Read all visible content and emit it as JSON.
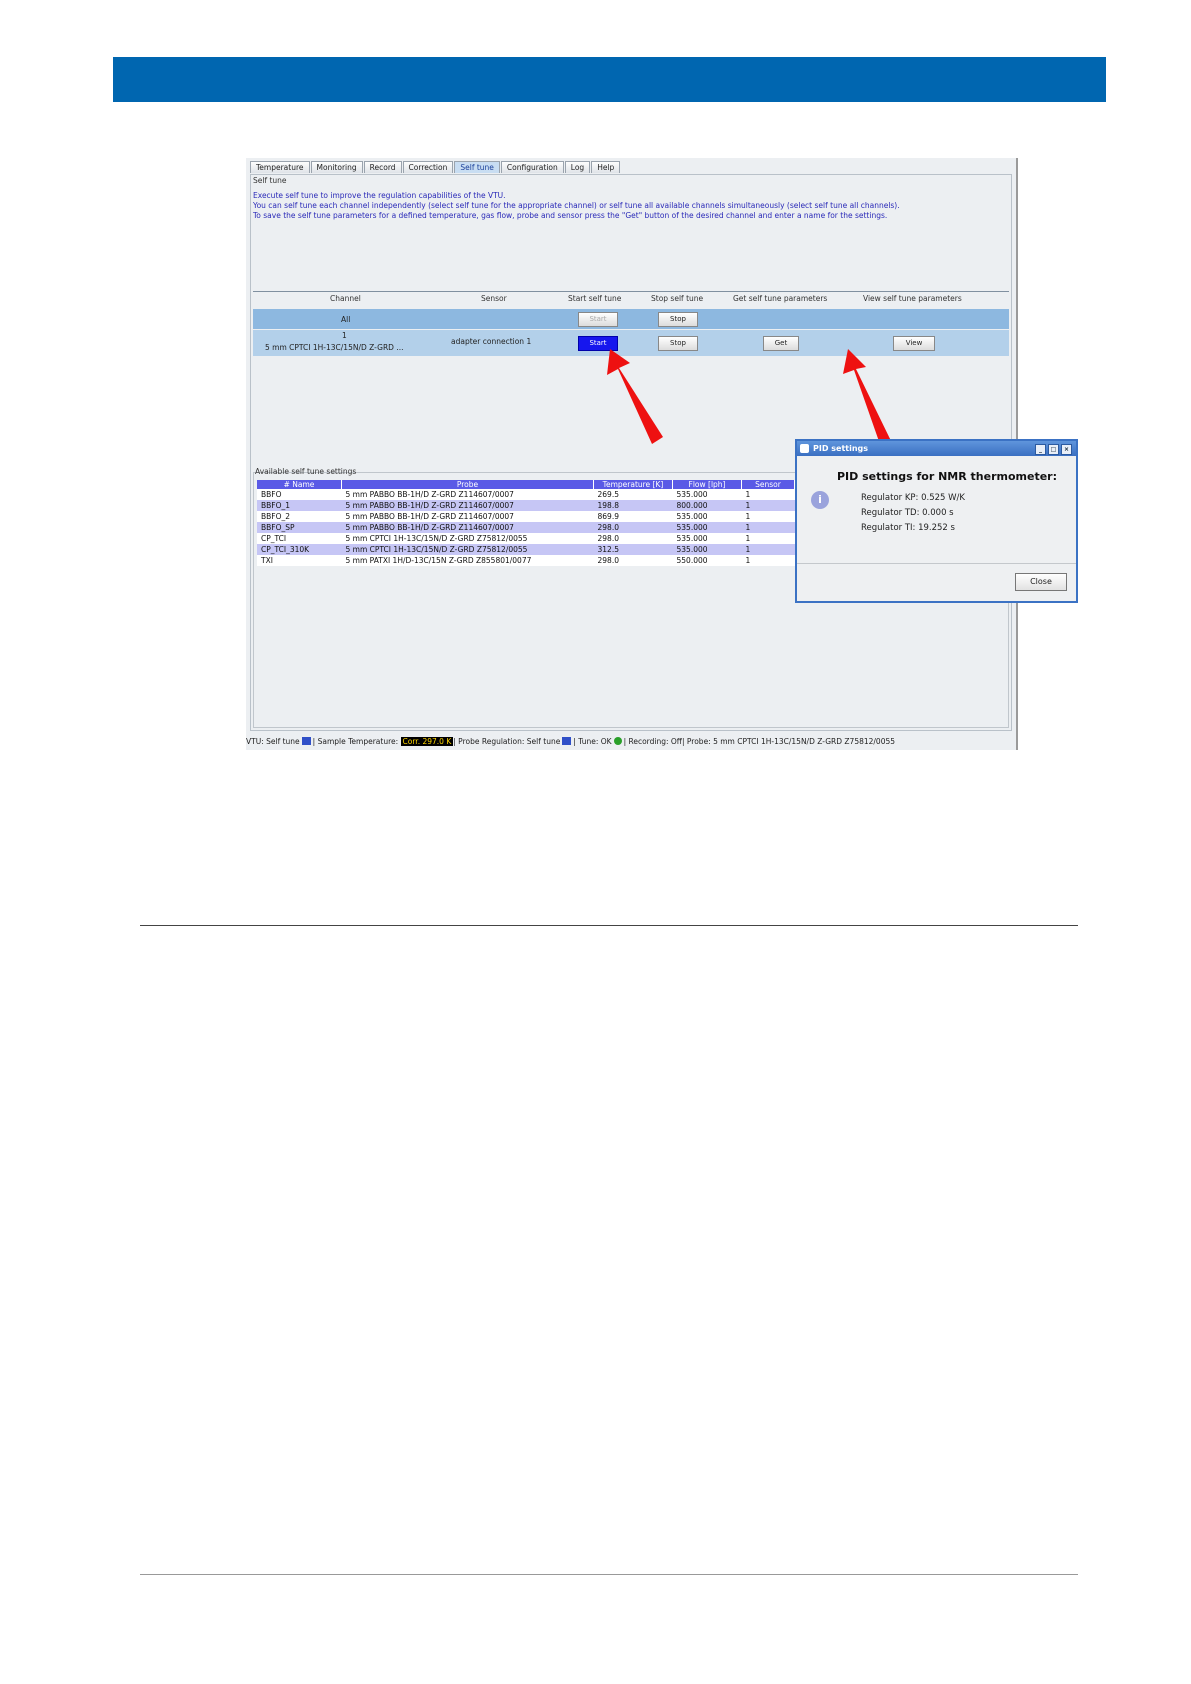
{
  "tabs": [
    "Temperature",
    "Monitoring",
    "Record",
    "Correction",
    "Self tune",
    "Configuration",
    "Log",
    "Help"
  ],
  "panel_title": "Self tune",
  "description": [
    "Execute self tune to improve the regulation capabilities of the VTU.",
    "You can self tune each channel independently (select self tune for the appropriate channel) or self tune all available channels simultaneously (select self tune all channels).",
    "To save the self tune parameters for a defined temperature, gas flow, probe and sensor press the \"Get\" button of the desired channel and enter a name for the settings."
  ],
  "channel_headers": {
    "channel": "Channel",
    "sensor": "Sensor",
    "start": "Start self tune",
    "stop": "Stop self tune",
    "get": "Get self tune parameters",
    "view": "View self tune parameters"
  },
  "row_all": {
    "label": "All",
    "start": "Start",
    "stop": "Stop"
  },
  "row_one": {
    "number": "1",
    "probe": "5 mm CPTCI 1H-13C/15N/D Z-GRD ...",
    "sensor": "adapter connection 1",
    "start": "Start",
    "stop": "Stop",
    "get": "Get",
    "view": "View"
  },
  "settings": {
    "legend": "Available self tune settings",
    "columns": [
      "# Name",
      "Probe",
      "Temperature [K]",
      "Flow [lph]",
      "Sensor"
    ],
    "rows": [
      [
        "BBFO",
        "5 mm PABBO BB-1H/D Z-GRD Z114607/0007",
        "269.5",
        "535.000",
        "1"
      ],
      [
        "BBFO_1",
        "5 mm PABBO BB-1H/D Z-GRD Z114607/0007",
        "198.8",
        "800.000",
        "1"
      ],
      [
        "BBFO_2",
        "5 mm PABBO BB-1H/D Z-GRD Z114607/0007",
        "869.9",
        "535.000",
        "1"
      ],
      [
        "BBFO_SP",
        "5 mm PABBO BB-1H/D Z-GRD Z114607/0007",
        "298.0",
        "535.000",
        "1"
      ],
      [
        "CP_TCI",
        "5 mm CPTCI 1H-13C/15N/D Z-GRD Z75812/0055",
        "298.0",
        "535.000",
        "1"
      ],
      [
        "CP_TCI_310K",
        "5 mm CPTCI 1H-13C/15N/D Z-GRD Z75812/0055",
        "312.5",
        "535.000",
        "1"
      ],
      [
        "TXI",
        "5 mm PATXI 1H/D-13C/15N Z-GRD Z855801/0077",
        "298.0",
        "550.000",
        "1"
      ]
    ]
  },
  "status": {
    "vtu": "VTU: Self tune",
    "sample": "Sample Temperature:",
    "corr": "Corr. 297.0 K",
    "probe_reg": "Probe Regulation: Self tune",
    "tune": "Tune: OK",
    "recording": "Recording: Off",
    "probe": "Probe: 5 mm CPTCI 1H-13C/15N/D Z-GRD Z75812/0055"
  },
  "dialog": {
    "title": "PID settings",
    "heading": "PID settings for NMR thermometer:",
    "kp": "Regulator KP:  0.525 W/K",
    "td": "Regulator TD:  0.000 s",
    "ti": "Regulator TI:   19.252 s",
    "close": "Close"
  },
  "colors": {
    "banner": "#0066b0",
    "arrow": "#ee1111"
  }
}
